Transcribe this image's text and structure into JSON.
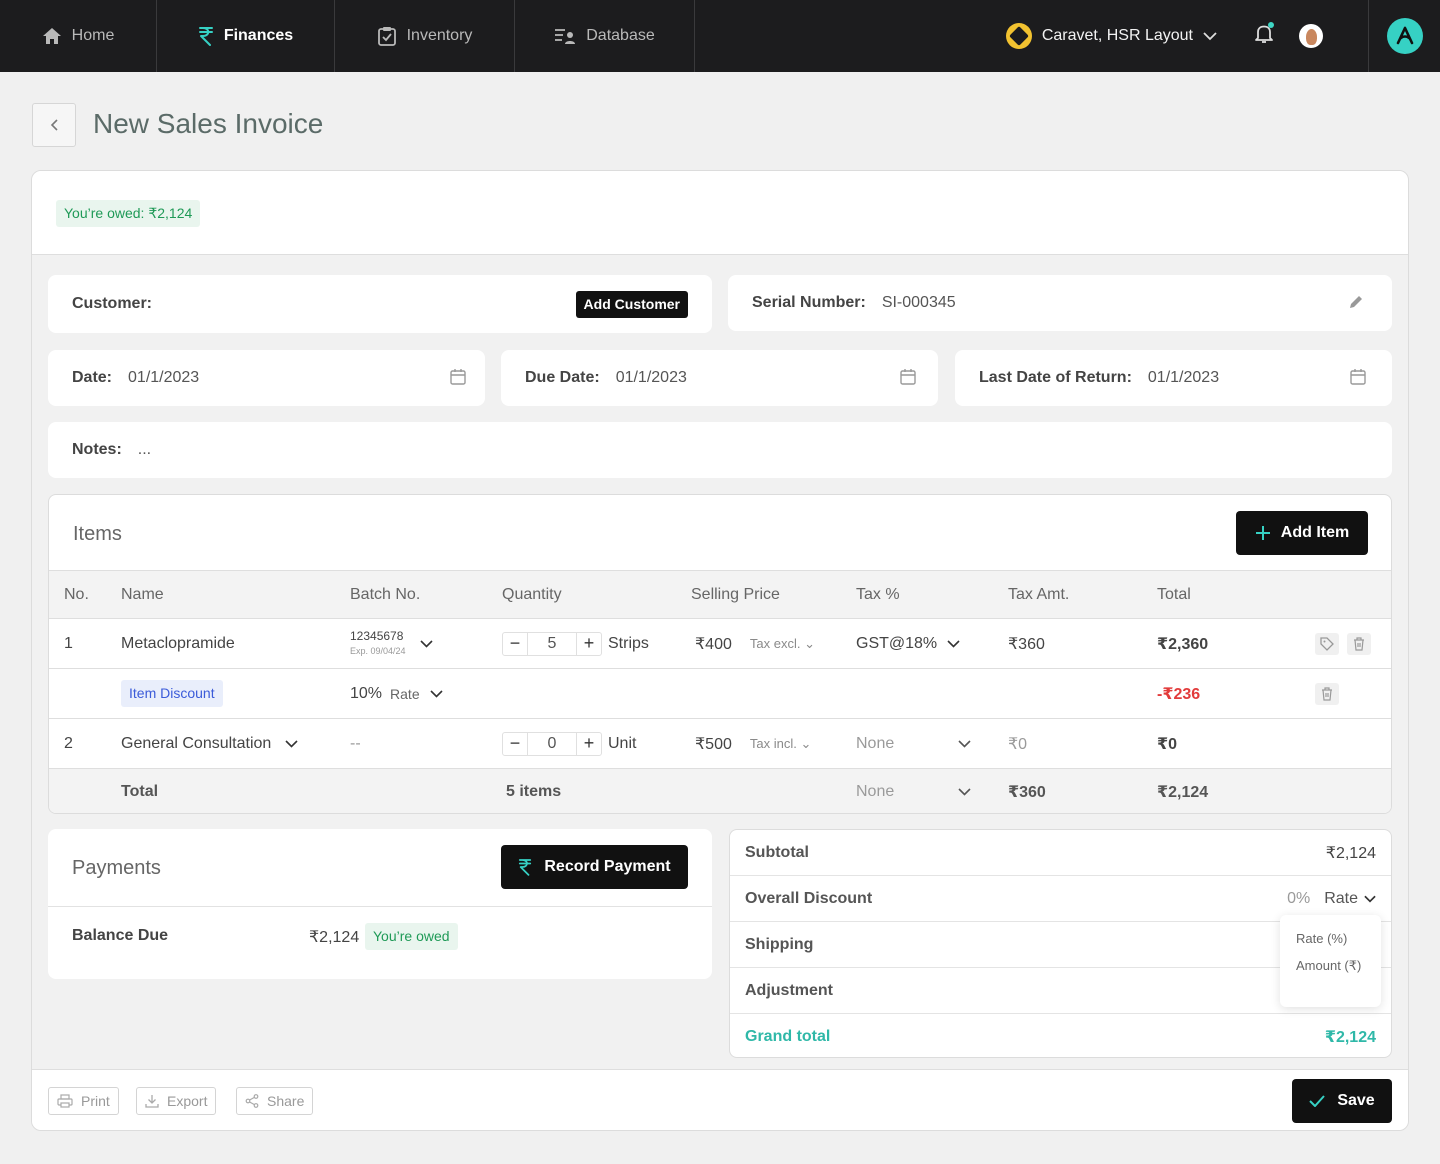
{
  "nav": {
    "tabs": [
      {
        "label": "Home",
        "icon": "home-icon"
      },
      {
        "label": "Finances",
        "icon": "rupee-icon"
      },
      {
        "label": "Inventory",
        "icon": "clipboard-check-icon"
      },
      {
        "label": "Database",
        "icon": "user-list-icon"
      }
    ],
    "active_tab": "Finances",
    "org_name": "Caravet, HSR Layout"
  },
  "page": {
    "title": "New Sales Invoice",
    "owed_badge": "You’re owed: ₹2,124"
  },
  "form": {
    "customer_label": "Customer:",
    "add_customer": "Add Customer",
    "serial_label": "Serial Number:",
    "serial_value": "SI-000345",
    "date_label": "Date:",
    "date_value": "01/1/2023",
    "due_label": "Due Date:",
    "due_value": "01/1/2023",
    "return_label": "Last Date of Return:",
    "return_value": "01/1/2023",
    "notes_label": "Notes:",
    "notes_value": "..."
  },
  "items": {
    "title": "Items",
    "add_item": "Add Item",
    "columns": [
      "No.",
      "Name",
      "Batch No.",
      "Quantity",
      "Selling Price",
      "Tax %",
      "Tax Amt.",
      "Total"
    ],
    "rows": [
      {
        "no": "1",
        "name": "Metaclopramide",
        "batch": "12345678",
        "expiry": "Exp. 09/04/24",
        "qty": "5",
        "unit": "Strips",
        "price": "₹400",
        "tax_mode": "Tax excl.",
        "tax": "GST@18%",
        "tax_amt": "₹360",
        "total": "₹2,360"
      },
      {
        "no": "2",
        "name": "General Consultation",
        "batch": "--",
        "qty": "0",
        "unit": "Unit",
        "price": "₹500",
        "tax_mode": "Tax incl.",
        "tax": "None",
        "tax_amt": "₹0",
        "total": "₹0"
      }
    ],
    "discount": {
      "label": "Item Discount",
      "value": "10%",
      "mode": "Rate",
      "amount": "-₹236"
    },
    "total_row": {
      "label": "Total",
      "count": "5 items",
      "tax": "None",
      "tax_amt": "₹360",
      "total": "₹2,124"
    }
  },
  "payments": {
    "title": "Payments",
    "record": "Record Payment",
    "balance_label": "Balance Due",
    "balance_value": "₹2,124",
    "badge": "You’re owed"
  },
  "summary": {
    "subtotal_label": "Subtotal",
    "subtotal_value": "₹2,124",
    "discount_label": "Overall Discount",
    "discount_value": "0%",
    "discount_mode": "Rate",
    "shipping_label": "Shipping",
    "adjustment_label": "Adjustment",
    "grand_label": "Grand total",
    "grand_value": "₹2,124",
    "dropdown_options": [
      "Rate (%)",
      "Amount (₹)"
    ]
  },
  "footer": {
    "print": "Print",
    "export": "Export",
    "share": "Share",
    "save": "Save"
  },
  "colors": {
    "accent": "#36d1c4",
    "owed_green": "#1f9a57",
    "discount_red": "#e23b3b",
    "nav_bg": "#1c1c1e"
  }
}
